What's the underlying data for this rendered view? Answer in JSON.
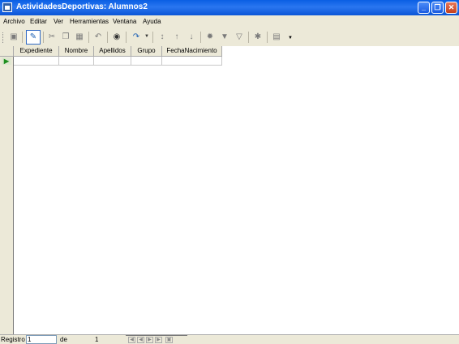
{
  "window": {
    "title": "ActividadesDeportivas: Alumnos2",
    "minimize_label": "_",
    "maximize_label": "❐",
    "close_label": "✕"
  },
  "menu": [
    {
      "label": "Archivo"
    },
    {
      "label": "Editar"
    },
    {
      "label": "Ver"
    },
    {
      "label": "Herramientas"
    },
    {
      "label": "Ventana"
    },
    {
      "label": "Ayuda"
    }
  ],
  "toolbar": {
    "icons": [
      "save-icon",
      "edit-mode-icon",
      "cut-icon",
      "copy-icon",
      "paste-icon",
      "undo-icon",
      "find-icon",
      "redo-icon",
      "sort-icon",
      "sort-ascending-icon",
      "sort-descending-icon",
      "autofilter-icon",
      "apply-filter-icon",
      "standard-filter-icon",
      "remove-filter-icon",
      "data-to-text-icon",
      "toolbar-options-icon"
    ]
  },
  "grid": {
    "columns": [
      "Expediente",
      "Nombre",
      "Apellidos",
      "Grupo",
      "FechaNacimiento"
    ],
    "new_row_marker": "▶"
  },
  "status": {
    "record_label": "Registro",
    "record_value": "1",
    "of_label": "de",
    "total": "1"
  }
}
